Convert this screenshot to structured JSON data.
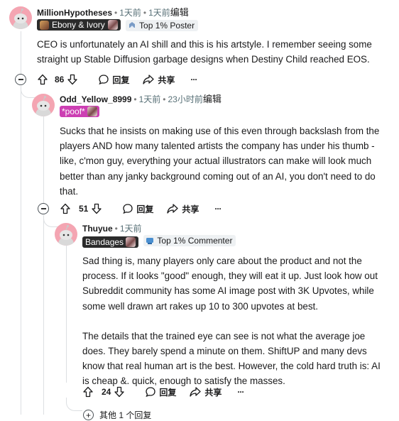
{
  "comments": [
    {
      "username": "MillionHypotheses",
      "time": "1天前",
      "edited_time": "1天前",
      "edited_label": "编辑",
      "user_flair": "Ebony & Ivory",
      "achievement": "Top 1% Poster",
      "body": [
        "CEO is unfortunately an AI shill and this is his artstyle. I remember seeing some straight up Stable Diffusion garbage designs when Destiny Child reached EOS."
      ],
      "votes": "86",
      "reply_label": "回复",
      "share_label": "共享",
      "more_label": "···"
    },
    {
      "username": "Odd_Yellow_8999",
      "time": "1天前",
      "edited_time": "23小时前",
      "edited_label": "编辑",
      "user_flair": "*poof*",
      "body": [
        "Sucks that he insists on making use of this even through backslash from the players AND how many talented artists the company has under his thumb - like, c'mon guy, everything your actual illustrators can make will look much better than any janky background coming out of an AI, you don't need to do that."
      ],
      "votes": "51",
      "reply_label": "回复",
      "share_label": "共享",
      "more_label": "···"
    },
    {
      "username": "Thuyue",
      "time": "1天前",
      "user_flair": "Bandages",
      "achievement": "Top 1% Commenter",
      "body": [
        "Sad thing is, many players only care about the product and not the process. If it looks \"good\" enough, they will eat it up. Just look how out Subreddit community has some AI image post with 3K Upvotes, while some well drawn art rakes up 10 to 300 upvotes at best.",
        "The details that the trained eye can see is not what the average joe does. They barely spend a minute on them. ShiftUP and many devs know that real human art is the best. However, the cold hard truth is: AI is cheap &. quick, enough to satisfy the masses."
      ],
      "votes": "24",
      "reply_label": "回复",
      "share_label": "共享",
      "more_label": "···"
    }
  ],
  "more_replies_label": "其他 1 个回复",
  "colors": {
    "avatar_bg": "#f4a5b2",
    "thread_line": "#dcdfe2",
    "flair_dark": "#2b2b2b",
    "flair_pink": "#cc3fb3",
    "achievement_bg": "#eef1f3"
  },
  "icons": [
    "snoo-avatar-icon",
    "upvote-icon",
    "downvote-icon",
    "comment-icon",
    "share-icon",
    "overflow-icon",
    "collapse-icon",
    "expand-icon",
    "achievement-icon"
  ]
}
